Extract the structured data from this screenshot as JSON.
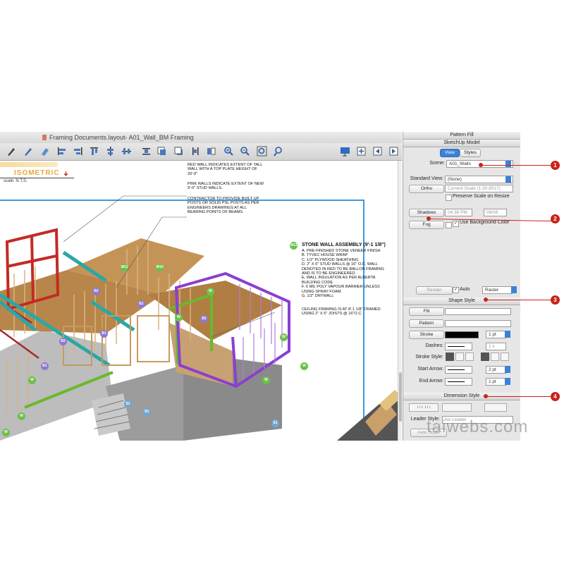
{
  "window": {
    "title": "Framing Documents.layout- A01_Wall_BM Framing"
  },
  "drawing": {
    "heading_fragment": "ISOMETRIC",
    "scale_label": "scale: N.T.S.",
    "notes": {
      "red_walls": [
        "RED WALL INDICATES EXTENT OF TALL",
        "WALL WITH A TOP PLATE HEIGHT OF",
        "20'-0\""
      ],
      "pink_walls": [
        "PINK WALLS INDICATE EXTENT OF NEW",
        "9'-0\" STUD WALLS."
      ],
      "contractor": [
        "CONTRACTOR TO PROVIDE BUILT UP",
        "POSTS OR SOLID PSL POSTS AS PER",
        "ENGINEERS DRAWINGS AT ALL",
        "BEARING POINTS OF BEAMS."
      ],
      "assembly_title": "STONE WALL ASSEMBLY (9'-1 1/8\")",
      "assembly_lines": [
        "A. PRE-FINISHED STONE VENEER FINISH",
        "B. TYVEC HOUSE WRAP",
        "C. 1/2\" PLYWOOD SHEATHING",
        "D. 2\" X 6\" STUD WALLS @ 16\" O.C. WALL",
        "DENOTED IN RED TO BE BALLON FRAMING",
        "AND IS TO BE ENGINEERED.",
        "E. WALL INSULATION AS PER ALBERTA",
        "BUILDING CODE",
        "F. 6 MIL POLY VAPOUR BARRIER UNLESS",
        "USING SPRAY FOAM.",
        "G. 1/2\" DRYWALL"
      ],
      "ceiling": [
        "CEILING FRAMING IS AT 8'-1 1/8\" FRAMED",
        "USING 2\" X 6\" JOISTS @ 16\"O.C."
      ]
    },
    "markers": {
      "w11": "W11",
      "w10": "W10",
      "w": "W",
      "b1": "B1",
      "b2": "B2",
      "s1": "S1"
    }
  },
  "panel": {
    "pattern_fill": "Pattern Fill",
    "sketchup_model": "SketchUp Model",
    "tab_view": "View",
    "tab_styles": "Styles",
    "scene_label": "Scene:",
    "scene_value": "A01_Walls",
    "standard_view_label": "Standard View:",
    "standard_view_value": "(None)",
    "ortho_button": "Ortho",
    "current_scale": "Current Scale (1:30.8017)",
    "preserve_scale": "Preserve Scale on Resize",
    "shadows_button": "Shadows",
    "shadow_time": "04:38 PM",
    "shadow_date": "06/06",
    "fog_button": "Fog",
    "use_bg_color": "Use Background Color",
    "render_button": "Render",
    "auto_label": "Auto",
    "raster_value": "Raster",
    "shape_style": "Shape Style",
    "fill_button": "Fill",
    "pattern_button": "Pattern",
    "stroke_button": "Stroke",
    "stroke_width": "1 pt",
    "dashes_label": "Dashes:",
    "dash_scale": "1 x",
    "stroke_style_label": "Stroke Style:",
    "start_arrow_label": "Start Arrow:",
    "start_arrow_size": "2 pt",
    "end_arrow_label": "End Arrow:",
    "end_arrow_size": "1 pt",
    "dimension_style": "Dimension Style",
    "leader_style_label": "Leader Style:",
    "leader_style_value": "No Leader",
    "auto_scale": "Auto Scale"
  },
  "callouts": [
    "1",
    "2",
    "3",
    "4"
  ],
  "watermark": "taiwebs.com",
  "colors": {
    "callout": "#c8231c",
    "selection": "#3b9be0",
    "accent": "#3b82d6"
  }
}
